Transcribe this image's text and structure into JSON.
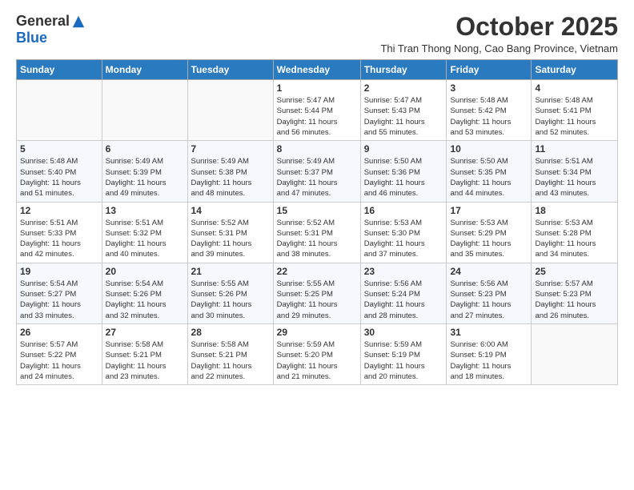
{
  "logo": {
    "general": "General",
    "blue": "Blue"
  },
  "title": "October 2025",
  "subtitle": "Thi Tran Thong Nong, Cao Bang Province, Vietnam",
  "weekdays": [
    "Sunday",
    "Monday",
    "Tuesday",
    "Wednesday",
    "Thursday",
    "Friday",
    "Saturday"
  ],
  "weeks": [
    [
      {
        "day": "",
        "info": ""
      },
      {
        "day": "",
        "info": ""
      },
      {
        "day": "",
        "info": ""
      },
      {
        "day": "1",
        "info": "Sunrise: 5:47 AM\nSunset: 5:44 PM\nDaylight: 11 hours\nand 56 minutes."
      },
      {
        "day": "2",
        "info": "Sunrise: 5:47 AM\nSunset: 5:43 PM\nDaylight: 11 hours\nand 55 minutes."
      },
      {
        "day": "3",
        "info": "Sunrise: 5:48 AM\nSunset: 5:42 PM\nDaylight: 11 hours\nand 53 minutes."
      },
      {
        "day": "4",
        "info": "Sunrise: 5:48 AM\nSunset: 5:41 PM\nDaylight: 11 hours\nand 52 minutes."
      }
    ],
    [
      {
        "day": "5",
        "info": "Sunrise: 5:48 AM\nSunset: 5:40 PM\nDaylight: 11 hours\nand 51 minutes."
      },
      {
        "day": "6",
        "info": "Sunrise: 5:49 AM\nSunset: 5:39 PM\nDaylight: 11 hours\nand 49 minutes."
      },
      {
        "day": "7",
        "info": "Sunrise: 5:49 AM\nSunset: 5:38 PM\nDaylight: 11 hours\nand 48 minutes."
      },
      {
        "day": "8",
        "info": "Sunrise: 5:49 AM\nSunset: 5:37 PM\nDaylight: 11 hours\nand 47 minutes."
      },
      {
        "day": "9",
        "info": "Sunrise: 5:50 AM\nSunset: 5:36 PM\nDaylight: 11 hours\nand 46 minutes."
      },
      {
        "day": "10",
        "info": "Sunrise: 5:50 AM\nSunset: 5:35 PM\nDaylight: 11 hours\nand 44 minutes."
      },
      {
        "day": "11",
        "info": "Sunrise: 5:51 AM\nSunset: 5:34 PM\nDaylight: 11 hours\nand 43 minutes."
      }
    ],
    [
      {
        "day": "12",
        "info": "Sunrise: 5:51 AM\nSunset: 5:33 PM\nDaylight: 11 hours\nand 42 minutes."
      },
      {
        "day": "13",
        "info": "Sunrise: 5:51 AM\nSunset: 5:32 PM\nDaylight: 11 hours\nand 40 minutes."
      },
      {
        "day": "14",
        "info": "Sunrise: 5:52 AM\nSunset: 5:31 PM\nDaylight: 11 hours\nand 39 minutes."
      },
      {
        "day": "15",
        "info": "Sunrise: 5:52 AM\nSunset: 5:31 PM\nDaylight: 11 hours\nand 38 minutes."
      },
      {
        "day": "16",
        "info": "Sunrise: 5:53 AM\nSunset: 5:30 PM\nDaylight: 11 hours\nand 37 minutes."
      },
      {
        "day": "17",
        "info": "Sunrise: 5:53 AM\nSunset: 5:29 PM\nDaylight: 11 hours\nand 35 minutes."
      },
      {
        "day": "18",
        "info": "Sunrise: 5:53 AM\nSunset: 5:28 PM\nDaylight: 11 hours\nand 34 minutes."
      }
    ],
    [
      {
        "day": "19",
        "info": "Sunrise: 5:54 AM\nSunset: 5:27 PM\nDaylight: 11 hours\nand 33 minutes."
      },
      {
        "day": "20",
        "info": "Sunrise: 5:54 AM\nSunset: 5:26 PM\nDaylight: 11 hours\nand 32 minutes."
      },
      {
        "day": "21",
        "info": "Sunrise: 5:55 AM\nSunset: 5:26 PM\nDaylight: 11 hours\nand 30 minutes."
      },
      {
        "day": "22",
        "info": "Sunrise: 5:55 AM\nSunset: 5:25 PM\nDaylight: 11 hours\nand 29 minutes."
      },
      {
        "day": "23",
        "info": "Sunrise: 5:56 AM\nSunset: 5:24 PM\nDaylight: 11 hours\nand 28 minutes."
      },
      {
        "day": "24",
        "info": "Sunrise: 5:56 AM\nSunset: 5:23 PM\nDaylight: 11 hours\nand 27 minutes."
      },
      {
        "day": "25",
        "info": "Sunrise: 5:57 AM\nSunset: 5:23 PM\nDaylight: 11 hours\nand 26 minutes."
      }
    ],
    [
      {
        "day": "26",
        "info": "Sunrise: 5:57 AM\nSunset: 5:22 PM\nDaylight: 11 hours\nand 24 minutes."
      },
      {
        "day": "27",
        "info": "Sunrise: 5:58 AM\nSunset: 5:21 PM\nDaylight: 11 hours\nand 23 minutes."
      },
      {
        "day": "28",
        "info": "Sunrise: 5:58 AM\nSunset: 5:21 PM\nDaylight: 11 hours\nand 22 minutes."
      },
      {
        "day": "29",
        "info": "Sunrise: 5:59 AM\nSunset: 5:20 PM\nDaylight: 11 hours\nand 21 minutes."
      },
      {
        "day": "30",
        "info": "Sunrise: 5:59 AM\nSunset: 5:19 PM\nDaylight: 11 hours\nand 20 minutes."
      },
      {
        "day": "31",
        "info": "Sunrise: 6:00 AM\nSunset: 5:19 PM\nDaylight: 11 hours\nand 18 minutes."
      },
      {
        "day": "",
        "info": ""
      }
    ]
  ]
}
